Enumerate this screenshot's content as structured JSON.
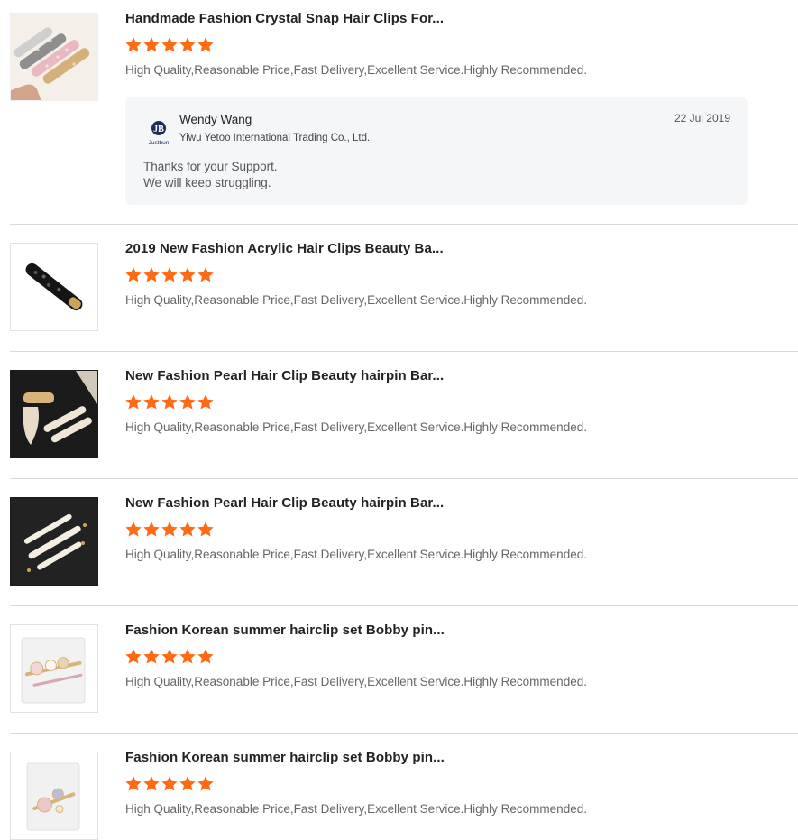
{
  "colors": {
    "star": "#ff6a14",
    "divider": "#d9d9d9",
    "reply_bg": "#f5f6f8"
  },
  "reviews": [
    {
      "title": "Handmade Fashion Crystal Snap Hair Clips For...",
      "rating": 5,
      "comment": "High Quality,Reasonable Price,Fast Delivery,Excellent Service.Highly Recommended.",
      "reply": {
        "logo_text": "Justbun",
        "name": "Wendy Wang",
        "company": "Yiwu Yetoo International Trading Co., Ltd.",
        "date": "22 Jul 2019",
        "lines": [
          "Thanks for your Support.",
          "We will keep struggling."
        ]
      }
    },
    {
      "title": "2019 New Fashion Acrylic Hair Clips Beauty Ba...",
      "rating": 5,
      "comment": "High Quality,Reasonable Price,Fast Delivery,Excellent Service.Highly Recommended."
    },
    {
      "title": "New Fashion Pearl Hair Clip Beauty hairpin Bar...",
      "rating": 5,
      "comment": "High Quality,Reasonable Price,Fast Delivery,Excellent Service.Highly Recommended."
    },
    {
      "title": "New Fashion Pearl Hair Clip Beauty hairpin Bar...",
      "rating": 5,
      "comment": "High Quality,Reasonable Price,Fast Delivery,Excellent Service.Highly Recommended."
    },
    {
      "title": "Fashion Korean summer hairclip set Bobby pin...",
      "rating": 5,
      "comment": "High Quality,Reasonable Price,Fast Delivery,Excellent Service.Highly Recommended."
    },
    {
      "title": "Fashion Korean summer hairclip set Bobby pin...",
      "rating": 5,
      "comment": "High Quality,Reasonable Price,Fast Delivery,Excellent Service.Highly Recommended."
    }
  ]
}
